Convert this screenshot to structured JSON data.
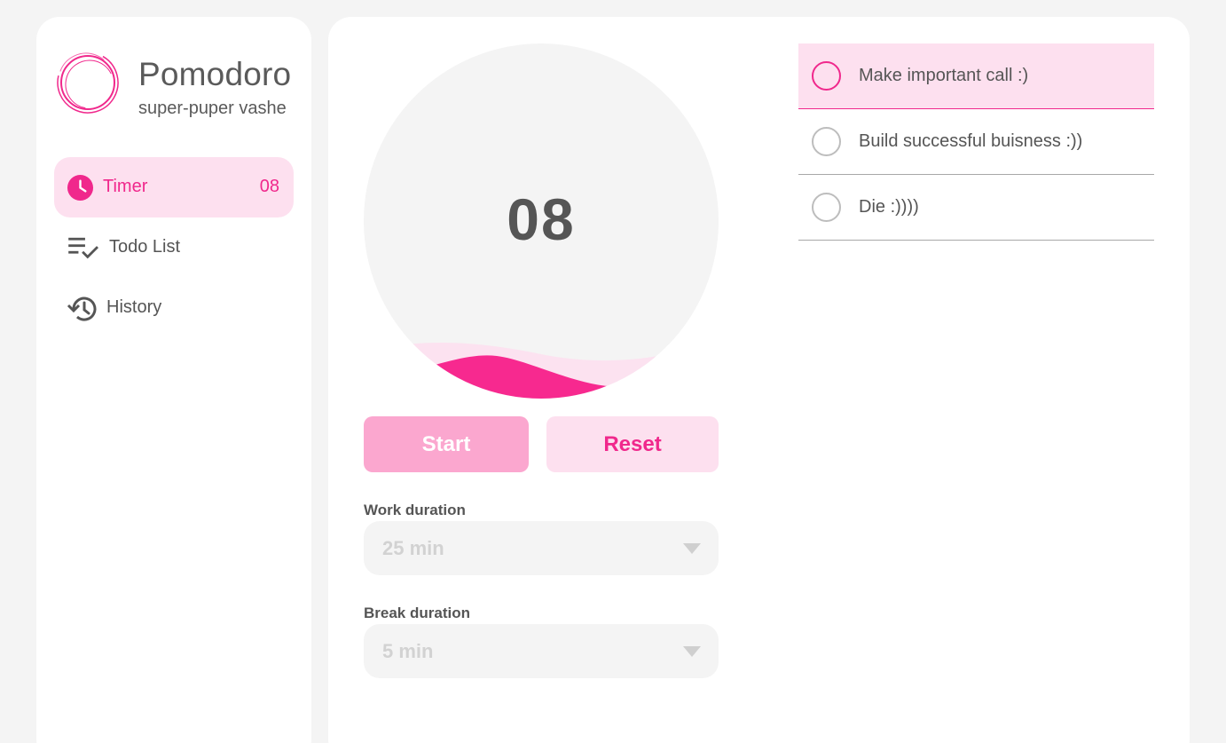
{
  "app": {
    "title": "Pomodoro",
    "subtitle": "super-puper vashe"
  },
  "nav": {
    "items": [
      {
        "label": "Timer",
        "icon": "clock-icon",
        "count": "08",
        "active": true
      },
      {
        "label": "Todo List",
        "icon": "checklist-icon",
        "active": false
      },
      {
        "label": "History",
        "icon": "history-icon",
        "active": false
      }
    ]
  },
  "timer": {
    "value": "08",
    "progress_fraction": 0.12
  },
  "controls": {
    "start_label": "Start",
    "reset_label": "Reset"
  },
  "settings": {
    "work_label": "Work duration",
    "work_value": "25 min",
    "break_label": "Break duration",
    "break_value": "5 min"
  },
  "todos": [
    {
      "text": "Make important call :)",
      "active": true
    },
    {
      "text": "Build successful buisness :))",
      "active": false
    },
    {
      "text": "Die :))))",
      "active": false
    }
  ],
  "colors": {
    "accent": "#f0288c",
    "accent_light": "#fde0ef",
    "start_button": "#fba7cf",
    "background": "#f4f4f4"
  }
}
